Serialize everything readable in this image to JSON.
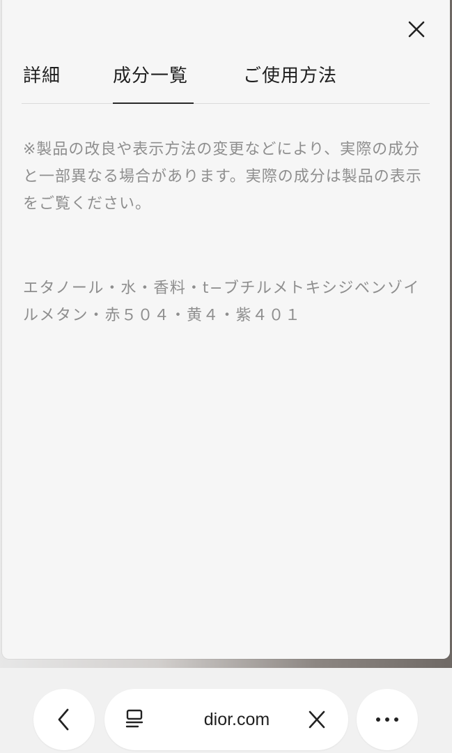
{
  "panel": {
    "close_icon": "close-icon",
    "tabs": [
      {
        "label": "詳細",
        "active": false
      },
      {
        "label": "成分一覧",
        "active": true
      },
      {
        "label": "ご使用方法",
        "active": false
      }
    ],
    "notice": "※製品の改良や表示方法の変更などにより、実際の成分と一部異なる場合があります。実際の成分は製品の表示をご覧ください。",
    "ingredients": "エタノール・水・香料・t−ブチルメトキシジベンゾイルメタン・赤５０４・黄４・紫４０１"
  },
  "browser_toolbar": {
    "back_icon": "chevron-left-icon",
    "tabs_icon": "tab-list-icon",
    "url": "dior.com",
    "clear_icon": "close-icon",
    "menu_icon": "more-dots-icon"
  }
}
